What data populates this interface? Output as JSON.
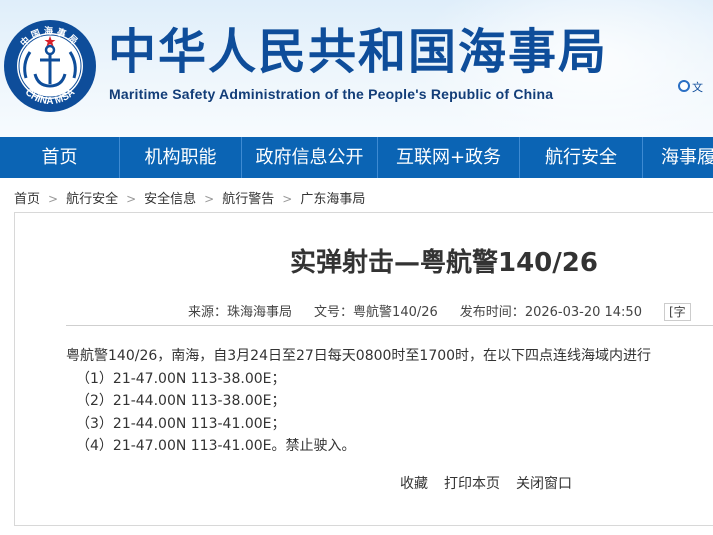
{
  "header": {
    "emblem_top_text": "中国海事局",
    "emblem_bottom_text": "CHINA MSA",
    "title_cn": "中华人民共和国海事局",
    "title_en": "Maritime Safety Administration of the People's Republic of China",
    "top_link": "文",
    "colors": {
      "brand_blue": "#0e4d9a",
      "nav_blue": "#0b64b4"
    }
  },
  "nav": {
    "items": [
      "首页",
      "机构职能",
      "政府信息公开",
      "互联网+政务",
      "航行安全",
      "海事履"
    ]
  },
  "breadcrumb": [
    "首页",
    "航行安全",
    "安全信息",
    "航行警告",
    "广东海事局"
  ],
  "article": {
    "title": "实弹射击—粤航警140/26",
    "source_label": "来源：",
    "source": "珠海海事局",
    "doc_no_label": "文号：",
    "doc_no": "粤航警140/26",
    "date_label": "发布时间：",
    "date": "2026-03-20 14:50",
    "font_label": "[字",
    "intro": "粤航警140/26，南海，自3月24日至27日每天0800时至1700时，在以下四点连线海域内进行",
    "points": [
      "（1）21-47.00N 113-38.00E；",
      "（2）21-44.00N 113-38.00E；",
      "（3）21-44.00N 113-41.00E；",
      "（4）21-47.00N 113-41.00E。禁止驶入。"
    ]
  },
  "actions": {
    "favorite": "收藏",
    "print": "打印本页",
    "close": "关闭窗口"
  }
}
